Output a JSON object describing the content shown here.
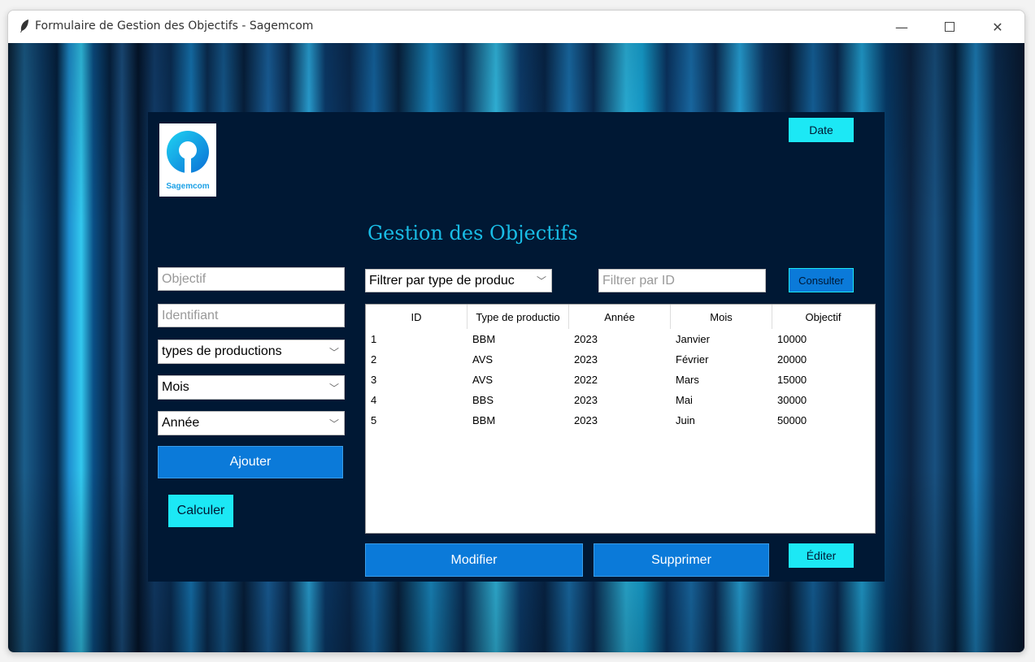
{
  "window": {
    "title": "Formulaire de Gestion des Objectifs - Sagemcom"
  },
  "logo": {
    "label": "Sagemcom"
  },
  "heading": "Gestion des Objectifs",
  "buttons": {
    "date": "Date",
    "consulter": "Consulter",
    "ajouter": "Ajouter",
    "calculer": "Calculer",
    "modifier": "Modifier",
    "supprimer": "Supprimer",
    "editer": "Éditer"
  },
  "form": {
    "objectif_placeholder": "Objectif",
    "identifiant_placeholder": "Identifiant",
    "type_select": "types de productions",
    "mois_select": "Mois",
    "annee_select": "Année"
  },
  "filters": {
    "type_select": "Filtrer par type de produc",
    "id_placeholder": "Filtrer par ID"
  },
  "table": {
    "columns": [
      "ID",
      "Type de productio",
      "Année",
      "Mois",
      "Objectif"
    ],
    "rows": [
      [
        "1",
        "BBM",
        "2023",
        "Janvier",
        "10000"
      ],
      [
        "2",
        "AVS",
        "2023",
        "Février",
        "20000"
      ],
      [
        "3",
        "AVS",
        "2022",
        "Mars",
        "15000"
      ],
      [
        "4",
        "BBS",
        "2023",
        "Mai",
        "30000"
      ],
      [
        "5",
        "BBM",
        "2023",
        "Juin",
        "50000"
      ]
    ]
  },
  "icons": {
    "app": "feather-icon",
    "minimize": "minimize-icon",
    "maximize": "maximize-icon",
    "close": "close-icon",
    "chevron": "chevron-down-icon"
  },
  "colors": {
    "panel": "#001834",
    "accent_cyan": "#1ce8f5",
    "button_blue": "#0b7ad9",
    "heading": "#19bde6"
  }
}
